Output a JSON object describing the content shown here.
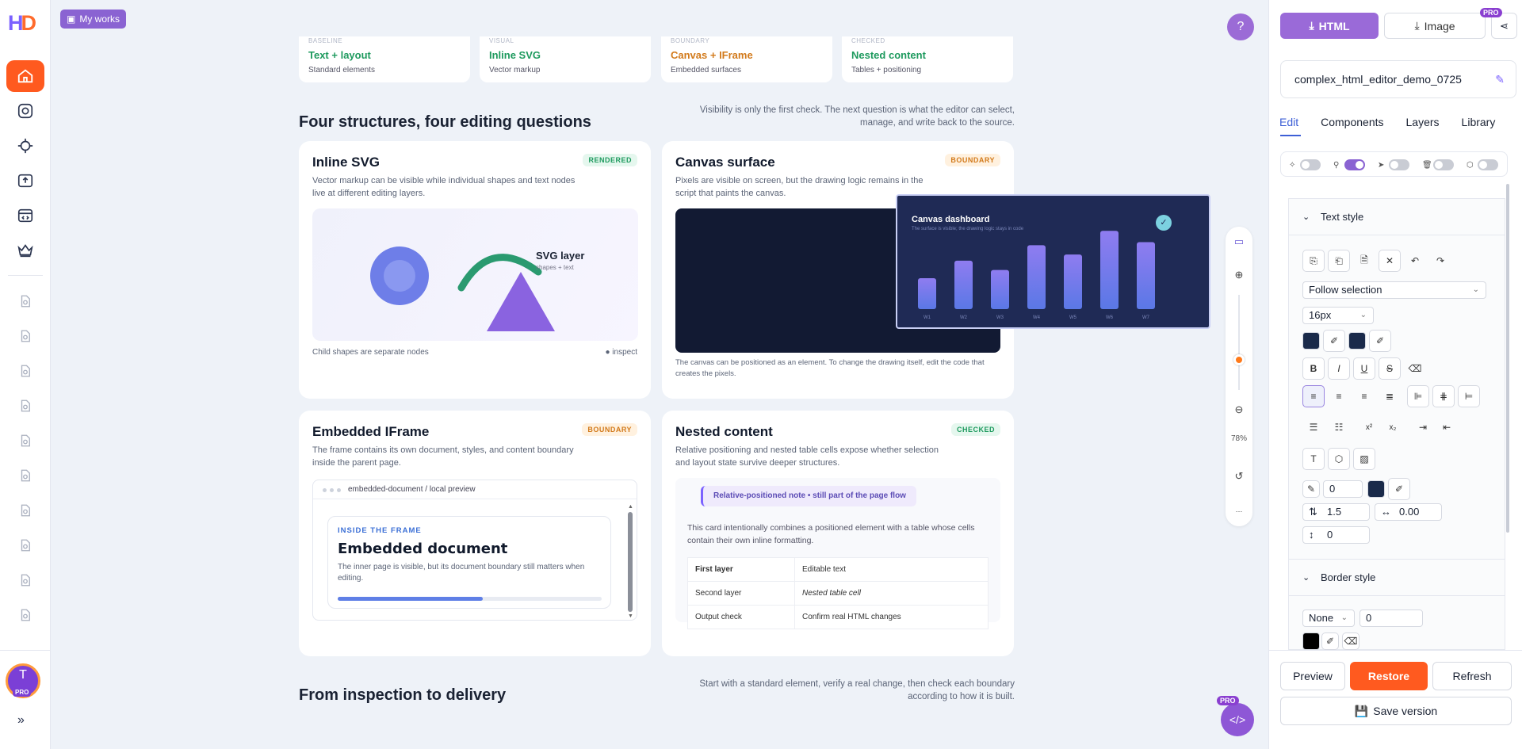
{
  "app": {
    "logo": "HD",
    "my_works": "My works"
  },
  "top_cards": [
    {
      "kicker": "BASELINE",
      "title": "Text + layout",
      "sub": "Standard elements",
      "color": "#1e9a5e"
    },
    {
      "kicker": "VISUAL",
      "title": "Inline SVG",
      "sub": "Vector markup",
      "color": "#1e9a5e"
    },
    {
      "kicker": "BOUNDARY",
      "title": "Canvas + IFrame",
      "sub": "Embedded surfaces",
      "color": "#d27a1b"
    },
    {
      "kicker": "CHECKED",
      "title": "Nested content",
      "sub": "Tables + positioning",
      "color": "#1e9a5e"
    }
  ],
  "section1": {
    "title": "Four structures, four editing questions",
    "note": "Visibility is only the first check. The next question is what the editor can select, manage, and write back to the source."
  },
  "cards": {
    "svg": {
      "title": "Inline SVG",
      "badge": "RENDERED",
      "desc": "Vector markup can be visible while individual shapes and text nodes live at different editing layers.",
      "layer_title": "SVG layer",
      "layer_sub": "shapes + text",
      "foot_left": "Child shapes are separate nodes",
      "foot_right": "● inspect"
    },
    "canvas": {
      "title": "Canvas surface",
      "badge": "BOUNDARY",
      "desc": "Pixels are visible on screen, but the drawing logic remains in the script that paints the canvas.",
      "foot": "The canvas can be positioned as an element. To change the drawing itself, edit the code that creates the pixels."
    },
    "iframe": {
      "title": "Embedded IFrame",
      "badge": "BOUNDARY",
      "desc": "The frame contains its own document, styles, and content boundary inside the parent page.",
      "bar": "embedded-document / local preview",
      "kicker": "INSIDE THE FRAME",
      "inner_title": "Embedded document",
      "inner_text": "The inner page is visible, but its document boundary still matters when editing.",
      "progress": 0.55
    },
    "nested": {
      "title": "Nested content",
      "badge": "CHECKED",
      "desc": "Relative positioning and nested table cells expose whether selection and layout state survive deeper structures.",
      "note": "Relative-positioned note • still part of the page flow",
      "text": "This card intentionally combines a positioned element with a table whose cells contain their own inline formatting.",
      "rows": [
        [
          "First layer",
          "Editable text"
        ],
        [
          "Second layer",
          "Nested table cell"
        ],
        [
          "Output check",
          "Confirm real HTML changes"
        ]
      ]
    }
  },
  "dashboard": {
    "title": "Canvas dashboard",
    "sub": "The surface is visible; the drawing logic stays in code",
    "labels": [
      "W1",
      "W2",
      "W3",
      "W4",
      "W5",
      "W6",
      "W7"
    ],
    "values": [
      0.3,
      0.47,
      0.38,
      0.62,
      0.53,
      0.76,
      0.65
    ]
  },
  "section2": {
    "title": "From inspection to delivery",
    "note": "Start with a standard element, verify a real change, then check each boundary according to how it is built."
  },
  "zoom": {
    "percent": "78%"
  },
  "panel": {
    "html_btn": "HTML",
    "image_btn": "Image",
    "pro": "PRO",
    "filename": "complex_html_editor_demo_0725",
    "tabs": [
      "Edit",
      "Components",
      "Layers",
      "Library"
    ],
    "text_style": "Text style",
    "follow": "Follow selection",
    "font_size": "16px",
    "indent": "0",
    "line_height": "1.5",
    "letter": "0.00",
    "spacing": "0",
    "border_style": "Border style",
    "border_type": "None",
    "border_width": "0",
    "preview": "Preview",
    "restore": "Restore",
    "refresh": "Refresh",
    "save": "Save version"
  },
  "avatar": {
    "letter": "T",
    "pro": "PRO"
  }
}
